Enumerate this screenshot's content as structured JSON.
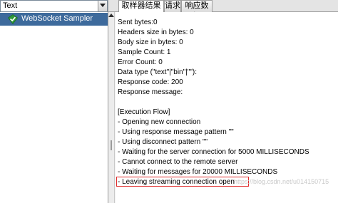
{
  "left_panel": {
    "type_select_value": "Text",
    "tree_items": [
      {
        "label": "WebSocket Sampler",
        "icon": "green-check-icon"
      }
    ]
  },
  "tabs": [
    {
      "label": "取样器结果",
      "active": true
    },
    {
      "label": "请求",
      "active": false
    },
    {
      "label": "响应数据",
      "active": false
    }
  ],
  "result_lines": [
    "Sent bytes:0",
    "Headers size in bytes: 0",
    "Body size in bytes: 0",
    "Sample Count: 1",
    "Error Count: 0",
    "Data type (\"text\"|\"bin\"|\"\"):",
    "Response code: 200",
    "Response message:",
    "",
    "[Execution Flow]",
    " - Opening new connection",
    " - Using response message pattern \"\"",
    " - Using disconnect pattern \"\"",
    " - Waiting for the server connection for 5000 MILLISECONDS",
    " - Cannot connect to the remote server",
    " - Waiting for messages for 20000 MILLISECONDS",
    " - Leaving streaming connection open"
  ],
  "highlighted_line_index": 16,
  "watermark": "https://blog.csdn.net/u014150715",
  "colors": {
    "selection": "#3d6a9c",
    "highlight_border": "#e02a2a",
    "check_green": "#2e9a3a"
  }
}
